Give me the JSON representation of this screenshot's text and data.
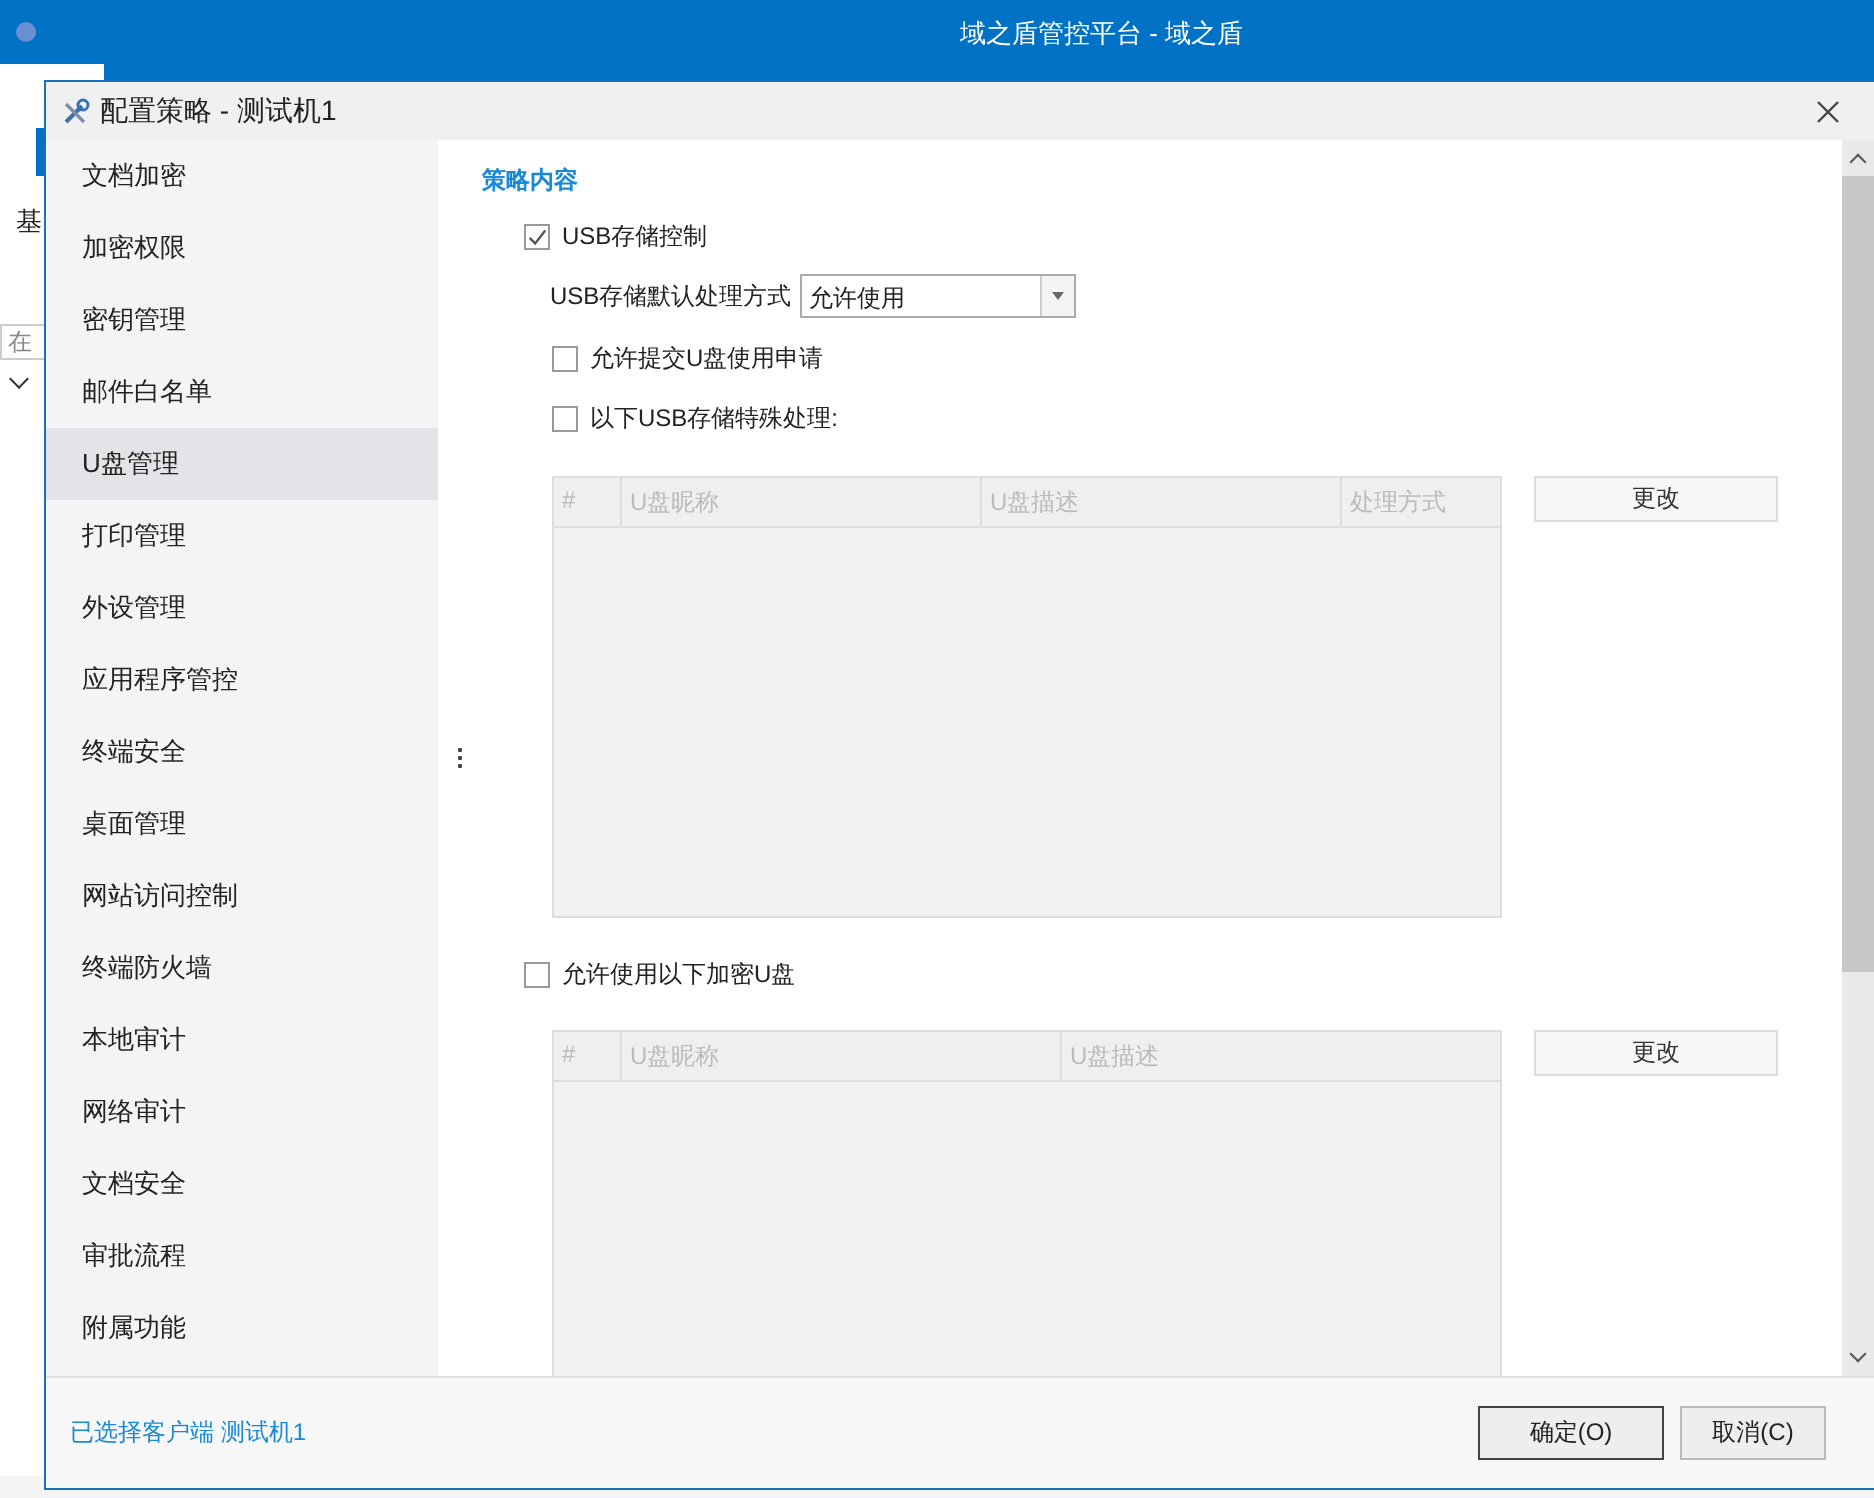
{
  "app": {
    "title": "域之盾管控平台 - 域之盾",
    "side_label": "基",
    "search": {
      "placeholder": "在"
    }
  },
  "dialog": {
    "title": "配置策略 - 测试机1",
    "nav": [
      {
        "label": "文档加密",
        "selected": false
      },
      {
        "label": "加密权限",
        "selected": false
      },
      {
        "label": "密钥管理",
        "selected": false
      },
      {
        "label": "邮件白名单",
        "selected": false
      },
      {
        "label": "U盘管理",
        "selected": true
      },
      {
        "label": "打印管理",
        "selected": false
      },
      {
        "label": "外设管理",
        "selected": false
      },
      {
        "label": "应用程序管控",
        "selected": false
      },
      {
        "label": "终端安全",
        "selected": false
      },
      {
        "label": "桌面管理",
        "selected": false
      },
      {
        "label": "网站访问控制",
        "selected": false
      },
      {
        "label": "终端防火墙",
        "selected": false
      },
      {
        "label": "本地审计",
        "selected": false
      },
      {
        "label": "网络审计",
        "selected": false
      },
      {
        "label": "文档安全",
        "selected": false
      },
      {
        "label": "审批流程",
        "selected": false
      },
      {
        "label": "附属功能",
        "selected": false
      }
    ],
    "section_title": "策略内容",
    "usb_control": {
      "label": "USB存储控制",
      "checked": true
    },
    "default_action": {
      "label": "USB存储默认处理方式",
      "value": "允许使用"
    },
    "options": [
      {
        "label": "允许提交U盘使用申请",
        "checked": false
      },
      {
        "label": "以下USB存储特殊处理:",
        "checked": false
      }
    ],
    "special_table": {
      "columns": [
        "#",
        "U盘昵称",
        "U盘描述",
        "处理方式"
      ],
      "button": "更改"
    },
    "encrypted": {
      "label": "允许使用以下加密U盘",
      "checked": false
    },
    "encrypted_table": {
      "columns": [
        "#",
        "U盘昵称",
        "U盘描述"
      ],
      "button": "更改"
    },
    "footer": {
      "selection": "已选择客户端 测试机1",
      "buttons": [
        "确定(O)",
        "取消(C)"
      ]
    }
  }
}
